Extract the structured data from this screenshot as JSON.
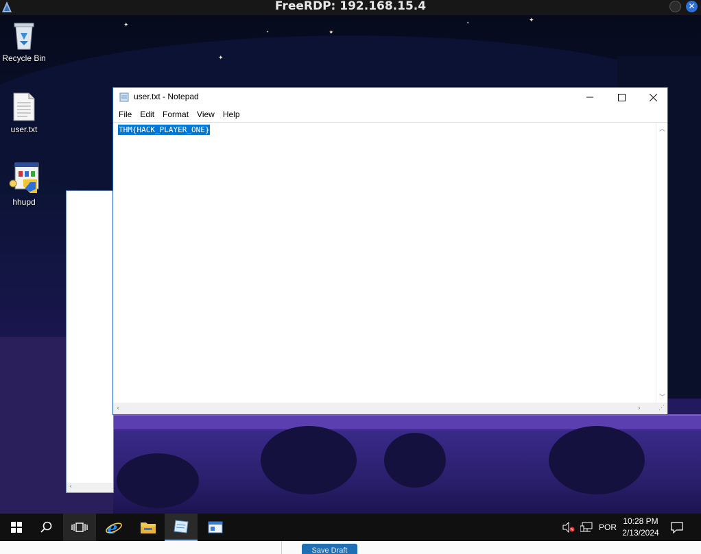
{
  "rdp": {
    "title": "FreeRDP: 192.168.15.4"
  },
  "desktop": {
    "icons": [
      {
        "label": "Recycle Bin",
        "icon": "recycle-bin-icon"
      },
      {
        "label": "user.txt",
        "icon": "text-file-icon"
      },
      {
        "label": "hhupd",
        "icon": "installer-icon"
      }
    ]
  },
  "notepad": {
    "title": "user.txt - Notepad",
    "menu": [
      "File",
      "Edit",
      "Format",
      "View",
      "Help"
    ],
    "content": "THM{HACK_PLAYER_ONE}",
    "content_selected": true
  },
  "taskbar": {
    "items": [
      "start-icon",
      "search-icon",
      "task-view-icon",
      "internet-explorer-icon",
      "file-explorer-icon",
      "notepad-icon",
      "window-app-icon"
    ],
    "language": "POR",
    "time": "10:28 PM",
    "date": "2/13/2024"
  },
  "below": {
    "button_label": "Save Draft"
  },
  "colors": {
    "selection": "#0078d7",
    "window_border": "#1f5fbf",
    "taskbar": "#101010"
  }
}
